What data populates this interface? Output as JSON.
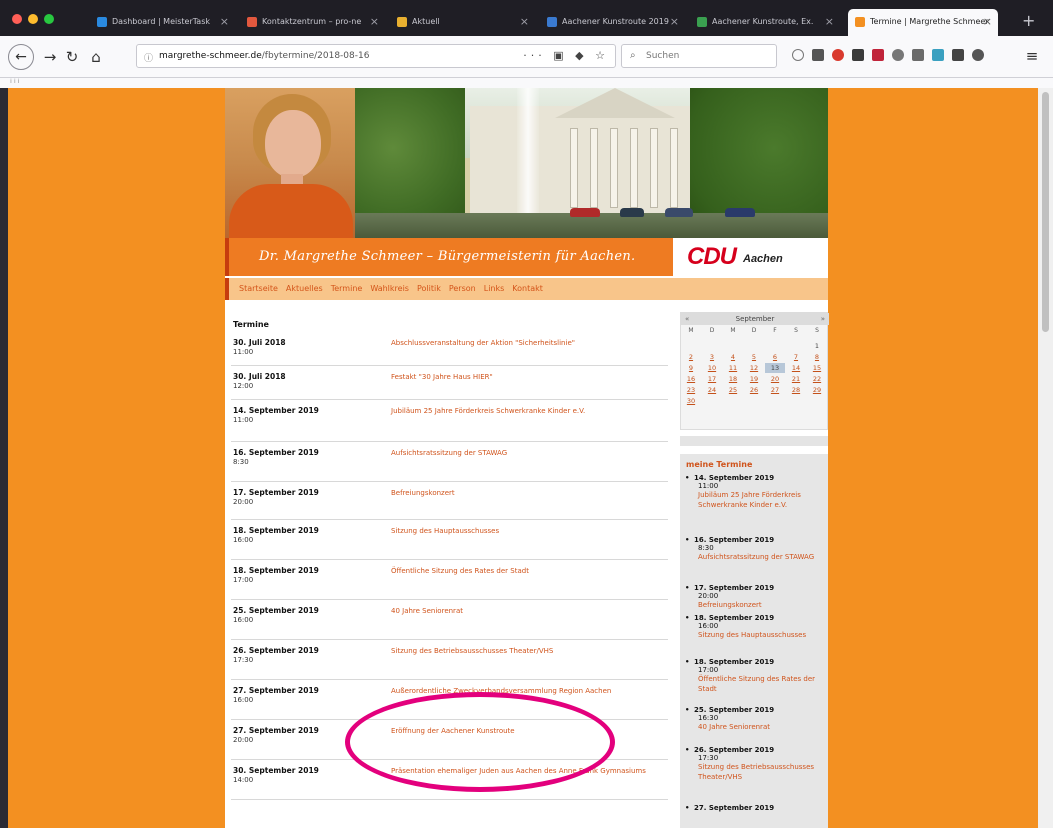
{
  "browser": {
    "tabs": [
      {
        "label": "Dashboard | MeisterTask",
        "color": "#2a8ae0"
      },
      {
        "label": "Kontaktzentrum – pro-ne",
        "color": "#e2583e"
      },
      {
        "label": "Aktuell",
        "color": "#e8b030"
      },
      {
        "label": "Aachener Kunstroute 2019",
        "color": "#3a7ad0"
      },
      {
        "label": "Aachener Kunstroute, Ex.",
        "color": "#3aa050"
      },
      {
        "label": "Termine | Margrethe Schmeer",
        "color": "#f39021"
      }
    ],
    "url_host": "margrethe-schmeer.de",
    "url_path": "/fbytermine/2018-08-16",
    "search_placeholder": "Suchen",
    "bookmarks_text": "⁞ ⁞ ⁞"
  },
  "site": {
    "title": "Dr. Margrethe Schmeer – Bürgermeisterin für Aachen.",
    "logo_main": "CDU",
    "logo_city": "Aachen",
    "menu": [
      "Startseite",
      "Aktuelles",
      "Termine",
      "Wahlkreis",
      "Politik",
      "Person",
      "Links",
      "Kontakt"
    ],
    "page_heading": "Termine"
  },
  "events": [
    {
      "date": "30. Juli 2018",
      "time": "11:00",
      "title": "Abschlussveranstaltung der Aktion \"Sicherheitslinie\""
    },
    {
      "date": "30. Juli 2018",
      "time": "12:00",
      "title": "Festakt \"30 Jahre Haus HIER\""
    },
    {
      "date": "14. September 2019",
      "time": "11:00",
      "title": "Jubiläum 25 Jahre Förderkreis Schwerkranke Kinder e.V."
    },
    {
      "date": "16. September 2019",
      "time": "8:30",
      "title": "Aufsichtsratssitzung der STAWAG"
    },
    {
      "date": "17. September 2019",
      "time": "20:00",
      "title": "Befreiungskonzert"
    },
    {
      "date": "18. September 2019",
      "time": "16:00",
      "title": "Sitzung des Hauptausschusses"
    },
    {
      "date": "18. September 2019",
      "time": "17:00",
      "title": "Öffentliche Sitzung des Rates der Stadt"
    },
    {
      "date": "25. September 2019",
      "time": "16:00",
      "title": "40 Jahre Seniorenrat"
    },
    {
      "date": "26. September 2019",
      "time": "17:30",
      "title": "Sitzung des Betriebsausschusses Theater/VHS"
    },
    {
      "date": "27. September 2019",
      "time": "16:00",
      "title": "Außerordentliche Zweckverbandsversammlung Region Aachen"
    },
    {
      "date": "27. September 2019",
      "time": "20:00",
      "title": "Eröffnung der Aachener Kunstroute"
    },
    {
      "date": "30. September 2019",
      "time": "14:00",
      "title": "Präsentation ehemaliger Juden aus Aachen des Anne Frank Gymnasiums"
    }
  ],
  "calendar": {
    "month": "September",
    "prev": "«",
    "next": "»",
    "weekdays": [
      "M",
      "D",
      "M",
      "D",
      "F",
      "S",
      "S"
    ],
    "weeks": [
      [
        "",
        "",
        "",
        "",
        "",
        "",
        "1"
      ],
      [
        "2",
        "3",
        "4",
        "5",
        "6",
        "7",
        "8"
      ],
      [
        "9",
        "10",
        "11",
        "12",
        "13",
        "14",
        "15"
      ],
      [
        "16",
        "17",
        "18",
        "19",
        "20",
        "21",
        "22"
      ],
      [
        "23",
        "24",
        "25",
        "26",
        "27",
        "28",
        "29"
      ],
      [
        "30",
        "",
        "",
        "",
        "",
        "",
        ""
      ]
    ]
  },
  "my_events": {
    "heading": "meine Termine",
    "items": [
      {
        "date": "14. September 2019",
        "time": "11:00",
        "title": "Jubiläum 25 Jahre Förderkreis Schwerkranke Kinder e.V."
      },
      {
        "date": "16. September 2019",
        "time": "8:30",
        "title": "Aufsichtsratssitzung der STAWAG"
      },
      {
        "date": "17. September 2019",
        "time": "20:00",
        "title": "Befreiungskonzert"
      },
      {
        "date": "18. September 2019",
        "time": "16:00",
        "title": "Sitzung des Hauptausschusses"
      },
      {
        "date": "18. September 2019",
        "time": "17:00",
        "title": "Öffentliche Sitzung des Rates der Stadt"
      },
      {
        "date": "25. September 2019",
        "time": "16:30",
        "title": "40 Jahre Seniorenrat"
      },
      {
        "date": "26. September 2019",
        "time": "17:30",
        "title": "Sitzung des Betriebsausschusses Theater/VHS"
      },
      {
        "date": "27. September 2019",
        "time": "",
        "title": ""
      }
    ]
  },
  "colors": {
    "page_bg": "#f39021",
    "title_bar": "#ee7b22",
    "link": "#d0541c",
    "annotation": "#e3007d"
  }
}
